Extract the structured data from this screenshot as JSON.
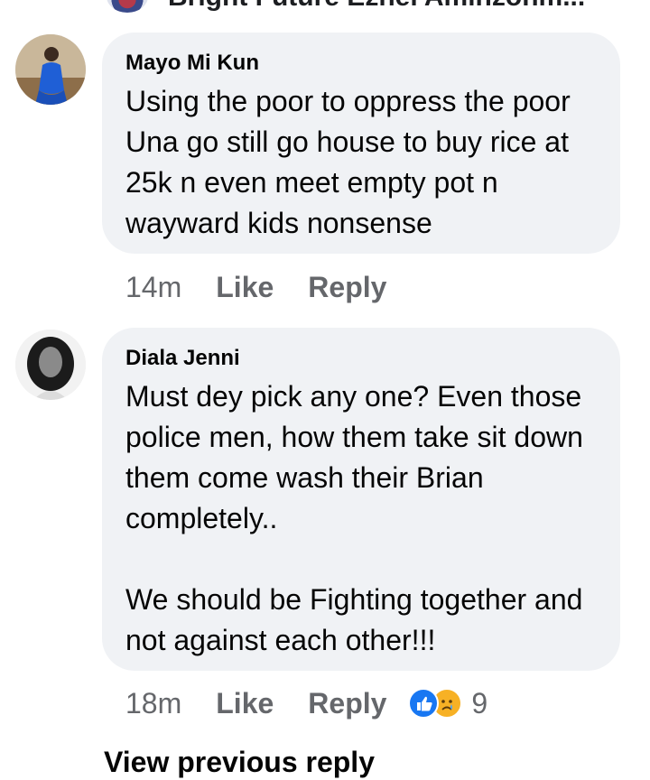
{
  "top_row": {
    "name_clipped": "Bright Future Ezhel Aminzonm..."
  },
  "comments": [
    {
      "author": "Mayo Mi Kun",
      "lines": [
        "Using the poor to oppress the poor",
        "Una go still go house to buy rice at",
        "25k n even meet empty pot n",
        "wayward kids nonsense"
      ],
      "time": "14m",
      "like_label": "Like",
      "reply_label": "Reply"
    },
    {
      "author": "Diala Jenni",
      "lines": [
        "Must dey pick any one? Even those",
        "police men, how them take sit down",
        "them come wash their Brian",
        "completely..",
        "",
        "We should be Fighting together and",
        "not against each other!!!"
      ],
      "time": "18m",
      "like_label": "Like",
      "reply_label": "Reply",
      "reactions": [
        "like-icon",
        "sad-icon"
      ],
      "reaction_count": "9"
    }
  ],
  "view_previous_label": "View previous reply",
  "colors": {
    "bubble": "#f0f2f5",
    "meta_text": "#65676b",
    "like_reaction": "#1877f2",
    "sad_reaction": "#f7b125"
  }
}
